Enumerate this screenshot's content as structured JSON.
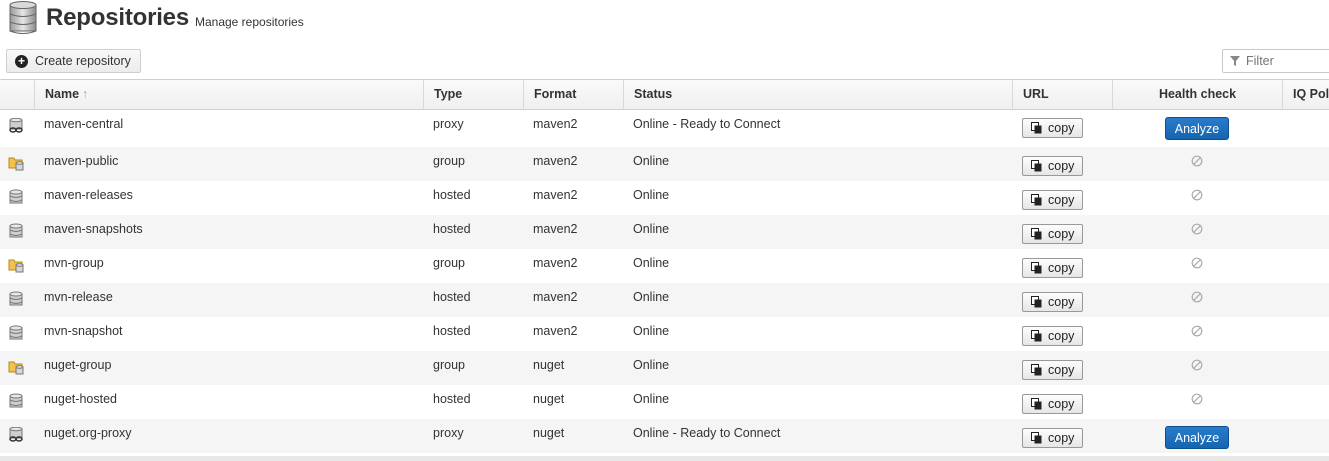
{
  "header": {
    "title": "Repositories",
    "subtitle": "Manage repositories",
    "icon": "database-stack-icon"
  },
  "toolbar": {
    "create_label": "Create repository",
    "filter_placeholder": "Filter"
  },
  "columns": {
    "name": "Name",
    "type": "Type",
    "format": "Format",
    "status": "Status",
    "url": "URL",
    "health": "Health check",
    "iq": "IQ Poli"
  },
  "copy_label": "copy",
  "analyze_label": "Analyze",
  "rows": [
    {
      "name": "maven-central",
      "type": "proxy",
      "format": "maven2",
      "status": "Online - Ready to Connect",
      "kind": "proxy",
      "health": "analyze"
    },
    {
      "name": "maven-public",
      "type": "group",
      "format": "maven2",
      "status": "Online",
      "kind": "group",
      "health": "na"
    },
    {
      "name": "maven-releases",
      "type": "hosted",
      "format": "maven2",
      "status": "Online",
      "kind": "hosted",
      "health": "na"
    },
    {
      "name": "maven-snapshots",
      "type": "hosted",
      "format": "maven2",
      "status": "Online",
      "kind": "hosted",
      "health": "na"
    },
    {
      "name": "mvn-group",
      "type": "group",
      "format": "maven2",
      "status": "Online",
      "kind": "group",
      "health": "na"
    },
    {
      "name": "mvn-release",
      "type": "hosted",
      "format": "maven2",
      "status": "Online",
      "kind": "hosted",
      "health": "na"
    },
    {
      "name": "mvn-snapshot",
      "type": "hosted",
      "format": "maven2",
      "status": "Online",
      "kind": "hosted",
      "health": "na"
    },
    {
      "name": "nuget-group",
      "type": "group",
      "format": "nuget",
      "status": "Online",
      "kind": "group",
      "health": "na"
    },
    {
      "name": "nuget-hosted",
      "type": "hosted",
      "format": "nuget",
      "status": "Online",
      "kind": "hosted",
      "health": "na"
    },
    {
      "name": "nuget.org-proxy",
      "type": "proxy",
      "format": "nuget",
      "status": "Online - Ready to Connect",
      "kind": "proxy",
      "health": "analyze"
    }
  ]
}
